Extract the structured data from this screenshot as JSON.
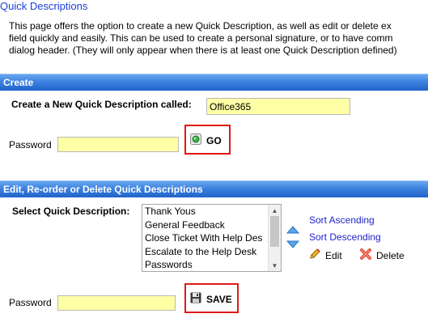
{
  "page": {
    "title": "Quick Descriptions",
    "description_lines": [
      "This page offers the option to create a new Quick Description, as well as edit or delete ex",
      "field quickly and easily. This can be used to create a personal signature, or to have comm",
      "dialog header. (They will only appear when there is at least one Quick Description defined)"
    ]
  },
  "create": {
    "header": "Create",
    "name_label": "Create a New Quick Description called:",
    "name_value": "Office365",
    "password_label": "Password",
    "password_value": "",
    "go_label": "GO"
  },
  "edit": {
    "header": "Edit, Re-order or Delete Quick Descriptions",
    "select_label": "Select Quick Description:",
    "items": [
      "Thank Yous",
      "General Feedback",
      "Close Ticket With Help Des",
      "Escalate to the Help Desk",
      "Passwords"
    ],
    "sort_ascending": "Sort Ascending",
    "sort_descending": "Sort Descending",
    "edit_label": "Edit",
    "delete_label": "Delete",
    "password_label": "Password",
    "password_value": "",
    "save_label": "SAVE"
  },
  "colors": {
    "header_bar": "#3d82e0",
    "input_background": "#ffffa6",
    "highlight_border": "#e01818",
    "link": "#2222cc"
  }
}
